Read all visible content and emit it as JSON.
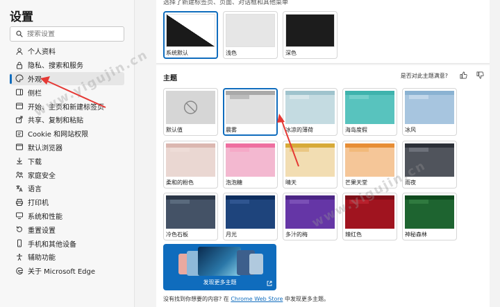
{
  "sidebar": {
    "title": "设置",
    "search_placeholder": "搜索设置",
    "items": [
      {
        "label": "个人资料",
        "icon": "profile-icon"
      },
      {
        "label": "隐私、搜索和服务",
        "icon": "lock-icon"
      },
      {
        "label": "外观",
        "icon": "palette-icon",
        "active": true
      },
      {
        "label": "侧栏",
        "icon": "sidebar-icon"
      },
      {
        "label": "开始、主页和新建标签页",
        "icon": "home-icon"
      },
      {
        "label": "共享、复制和粘贴",
        "icon": "share-icon"
      },
      {
        "label": "Cookie 和网站权限",
        "icon": "site-permissions-icon"
      },
      {
        "label": "默认浏览器",
        "icon": "browser-icon"
      },
      {
        "label": "下载",
        "icon": "download-icon"
      },
      {
        "label": "家庭安全",
        "icon": "family-icon"
      },
      {
        "label": "语言",
        "icon": "language-icon"
      },
      {
        "label": "打印机",
        "icon": "printer-icon"
      },
      {
        "label": "系统和性能",
        "icon": "system-icon"
      },
      {
        "label": "重置设置",
        "icon": "reset-icon"
      },
      {
        "label": "手机和其他设备",
        "icon": "phone-icon"
      },
      {
        "label": "辅助功能",
        "icon": "accessibility-icon"
      },
      {
        "label": "关于 Microsoft Edge",
        "icon": "edge-icon"
      }
    ]
  },
  "appearance": {
    "top_caption": "选择了新建标签页、页面、对话框和其他菜单",
    "modes": [
      {
        "label": "系统默认",
        "selected": true
      },
      {
        "label": "浅色"
      },
      {
        "label": "深色"
      }
    ]
  },
  "themes": {
    "heading": "主题",
    "satisfaction": "是否对此主题满意?",
    "items": [
      {
        "label": "默认值",
        "bar": "#d6d6d6",
        "tab": "#d6d6d6",
        "body": "#d6d6d6",
        "default": true
      },
      {
        "label": "晨雾",
        "bar": "#a9a9a9",
        "tab": "#bcbcbc",
        "body": "#e0e0e0",
        "selected": true
      },
      {
        "label": "冰凉的薄荷",
        "bar": "#9fc3cd",
        "tab": "#d7e6ea",
        "body": "#c4dbe1"
      },
      {
        "label": "海岛度假",
        "bar": "#3fb3ad",
        "tab": "#74cfca",
        "body": "#58c3be"
      },
      {
        "label": "冰风",
        "bar": "#8ab2d2",
        "tab": "#c2d7ea",
        "body": "#a7c5df"
      },
      {
        "label": "柔和的粉色",
        "bar": "#dbb7b0",
        "tab": "#eedcd7",
        "body": "#ead7d2"
      },
      {
        "label": "泡泡糖",
        "bar": "#ee6fa0",
        "tab": "#f5a9c7",
        "body": "#f3b8d0"
      },
      {
        "label": "晴天",
        "bar": "#d7aa39",
        "tab": "#eac783",
        "body": "#f2ddb2"
      },
      {
        "label": "芒果天堂",
        "bar": "#e78e36",
        "tab": "#f2b97a",
        "body": "#f5c698"
      },
      {
        "label": "雨夜",
        "bar": "#2c3038",
        "tab": "#6d717a",
        "body": "#50545c"
      },
      {
        "label": "冷色石板",
        "bar": "#2a3647",
        "tab": "#5a6a7d",
        "body": "#445266"
      },
      {
        "label": "月光",
        "bar": "#0d2d5e",
        "tab": "#2f5590",
        "body": "#1e447c"
      },
      {
        "label": "多汁的梅",
        "bar": "#4b2585",
        "tab": "#7a4fb6",
        "body": "#6536a6"
      },
      {
        "label": "辣红色",
        "bar": "#7e0e17",
        "tab": "#b8202c",
        "body": "#a0141f"
      },
      {
        "label": "神秘森林",
        "bar": "#0f4a1e",
        "tab": "#2f7a3f",
        "body": "#1e6430"
      }
    ],
    "discover_label": "发现更多主题",
    "footer_prefix": "没有找到你想要的内容? 在",
    "footer_link": "Chrome Web Store",
    "footer_suffix": "中发现更多主题。"
  },
  "watermarks": [
    "www.yigujin.cn",
    "www.yigujin.cn"
  ],
  "colors": {
    "accent": "#0f6cbd",
    "arrow": "#e53935"
  }
}
